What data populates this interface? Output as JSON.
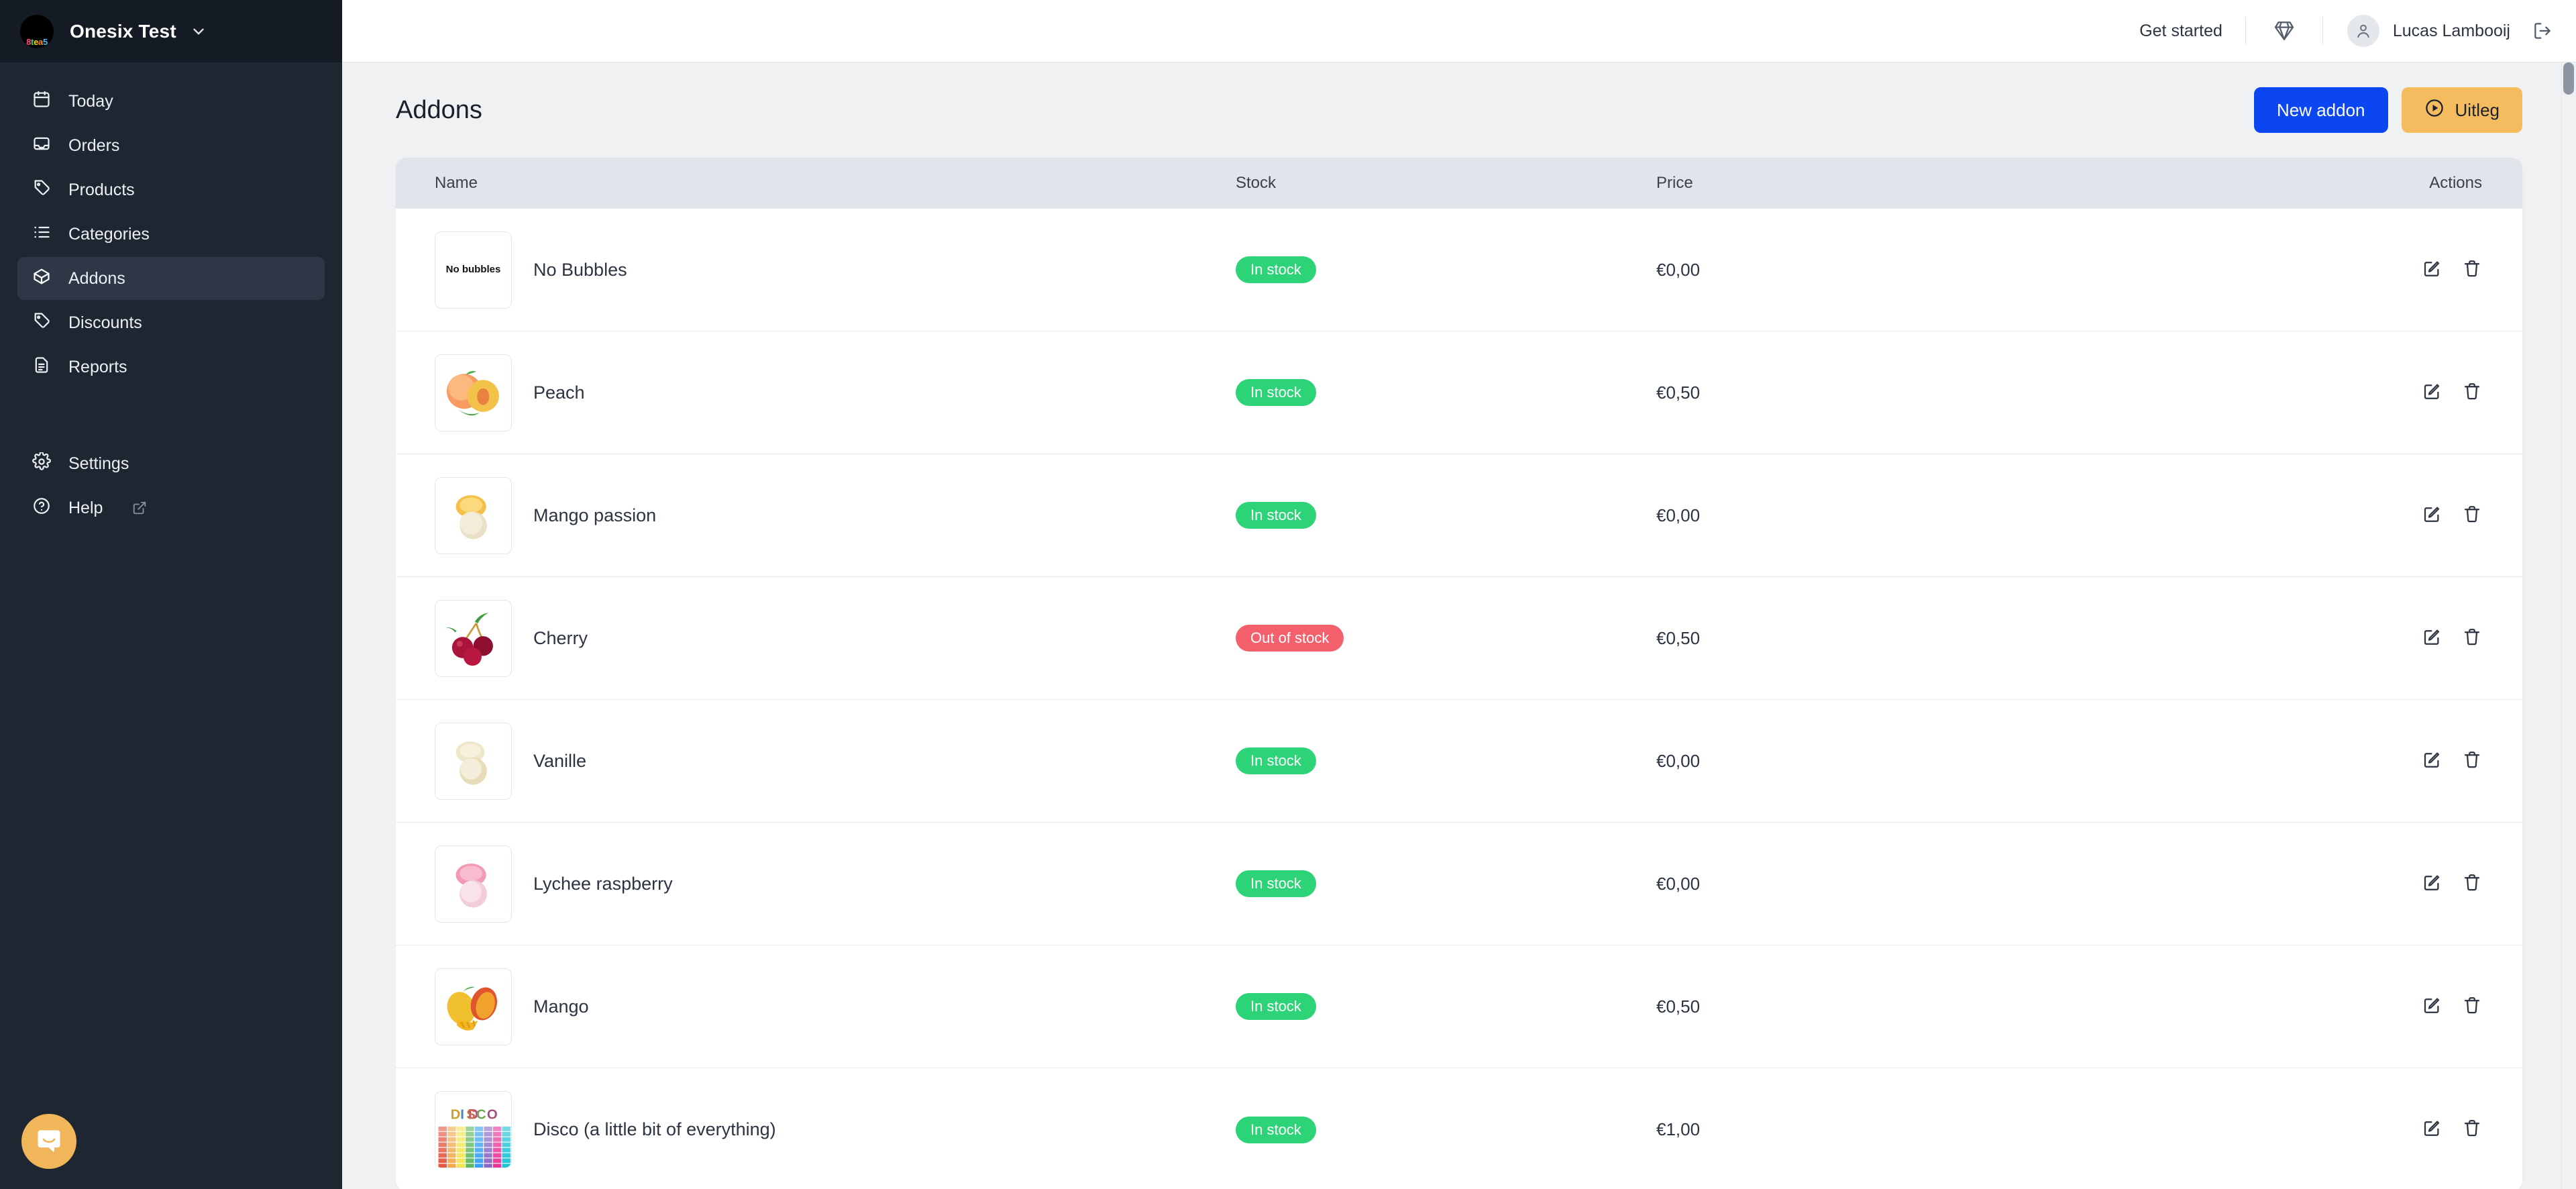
{
  "sidebar": {
    "brand": {
      "name": "Onesix Test",
      "logo_text": "8tea5",
      "caret_icon": "chevron-down-icon"
    },
    "items": [
      {
        "label": "Today",
        "icon": "calendar-icon",
        "active": false
      },
      {
        "label": "Orders",
        "icon": "inbox-icon",
        "active": false
      },
      {
        "label": "Products",
        "icon": "tag-icon",
        "active": false
      },
      {
        "label": "Categories",
        "icon": "list-icon",
        "active": false
      },
      {
        "label": "Addons",
        "icon": "box-icon",
        "active": true
      },
      {
        "label": "Discounts",
        "icon": "tag-icon",
        "active": false
      },
      {
        "label": "Reports",
        "icon": "document-icon",
        "active": false
      }
    ],
    "bottom_items": [
      {
        "label": "Settings",
        "icon": "gear-icon",
        "external": false
      },
      {
        "label": "Help",
        "icon": "question-circle-icon",
        "external": true
      }
    ],
    "support_launcher": {
      "icon": "intercom-chat-icon",
      "color": "#f2b65a"
    }
  },
  "topbar": {
    "get_started_label": "Get started",
    "diamond_icon": "diamond-icon",
    "user_name": "Lucas Lambooij",
    "avatar_icon": "user-icon",
    "logout_icon": "logout-icon"
  },
  "page": {
    "title": "Addons",
    "new_addon_label": "New addon",
    "uitleg_label": "Uitleg",
    "uitleg_icon": "play-circle-icon"
  },
  "table": {
    "columns": [
      "Name",
      "Stock",
      "Price",
      "Actions"
    ],
    "edit_icon": "edit-icon",
    "delete_icon": "trash-icon",
    "rows": [
      {
        "name": "No Bubbles",
        "thumb": "no-bubbles-text",
        "stock": "In stock",
        "stock_state": "in",
        "price": "€0,00"
      },
      {
        "name": "Peach",
        "thumb": "peach-photo",
        "stock": "In stock",
        "stock_state": "in",
        "price": "€0,50"
      },
      {
        "name": "Mango passion",
        "thumb": "mango-passion-photo",
        "stock": "In stock",
        "stock_state": "in",
        "price": "€0,00"
      },
      {
        "name": "Cherry",
        "thumb": "cherry-photo",
        "stock": "Out of stock",
        "stock_state": "out",
        "price": "€0,50"
      },
      {
        "name": "Vanille",
        "thumb": "vanille-photo",
        "stock": "In stock",
        "stock_state": "in",
        "price": "€0,00"
      },
      {
        "name": "Lychee raspberry",
        "thumb": "lychee-photo",
        "stock": "In stock",
        "stock_state": "in",
        "price": "€0,00"
      },
      {
        "name": "Mango",
        "thumb": "mango-photo",
        "stock": "In stock",
        "stock_state": "in",
        "price": "€0,50"
      },
      {
        "name": "Disco (a little bit of everything)",
        "thumb": "disco-photo",
        "stock": "In stock",
        "stock_state": "in",
        "price": "€1,00"
      }
    ]
  },
  "colors": {
    "sidebar_bg": "#1e2631",
    "primary": "#0b46f0",
    "warn": "#f5bc5f",
    "in_stock": "#2dd477",
    "out_of_stock": "#f4616d",
    "page_bg": "#f0f1f3"
  }
}
